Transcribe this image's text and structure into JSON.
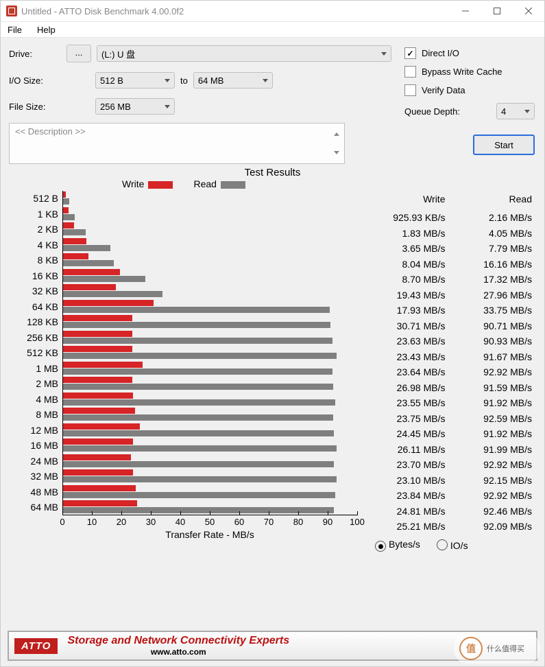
{
  "window": {
    "title": "Untitled - ATTO Disk Benchmark 4.00.0f2"
  },
  "menu": {
    "file": "File",
    "help": "Help"
  },
  "params": {
    "drive_label": "Drive:",
    "drive_value": "(L:) U 盘",
    "iosize_label": "I/O Size:",
    "iosize_from": "512 B",
    "iosize_to_label": "to",
    "iosize_to": "64 MB",
    "filesize_label": "File Size:",
    "filesize_value": "256 MB",
    "ellipsis": "..."
  },
  "options": {
    "direct_io": "Direct I/O",
    "bypass": "Bypass Write Cache",
    "verify": "Verify Data",
    "queue_depth_label": "Queue Depth:",
    "queue_depth_value": "4",
    "start": "Start"
  },
  "description": {
    "placeholder": "<< Description >>"
  },
  "results_title": "Test Results",
  "legend": {
    "write": "Write",
    "read": "Read"
  },
  "xaxis_title": "Transfer Rate - MB/s",
  "value_header": {
    "write": "Write",
    "read": "Read"
  },
  "unit": {
    "bytes": "Bytes/s",
    "ios": "IO/s"
  },
  "footer": {
    "logo": "ATTO",
    "text": "Storage and Network Connectivity Experts",
    "sub": "www.atto.com"
  },
  "watermark": {
    "glyph": "值",
    "text": "什么值得买"
  },
  "chart_data": {
    "type": "bar",
    "title": "Test Results",
    "xlabel": "Transfer Rate - MB/s",
    "ylabel": "",
    "xlim": [
      0,
      100
    ],
    "xticks": [
      0,
      10,
      20,
      30,
      40,
      50,
      60,
      70,
      80,
      90,
      100
    ],
    "categories": [
      "512 B",
      "1 KB",
      "2 KB",
      "4 KB",
      "8 KB",
      "16 KB",
      "32 KB",
      "64 KB",
      "128 KB",
      "256 KB",
      "512 KB",
      "1 MB",
      "2 MB",
      "4 MB",
      "8 MB",
      "12 MB",
      "16 MB",
      "24 MB",
      "32 MB",
      "48 MB",
      "64 MB"
    ],
    "series": [
      {
        "name": "Write",
        "color": "#d62427",
        "values_mb_s": [
          0.926,
          1.83,
          3.65,
          8.04,
          8.7,
          19.43,
          17.93,
          30.71,
          23.63,
          23.43,
          23.64,
          26.98,
          23.55,
          23.75,
          24.45,
          26.11,
          23.7,
          23.1,
          23.84,
          24.81,
          25.21
        ],
        "display": [
          "925.93 KB/s",
          "1.83 MB/s",
          "3.65 MB/s",
          "8.04 MB/s",
          "8.70 MB/s",
          "19.43 MB/s",
          "17.93 MB/s",
          "30.71 MB/s",
          "23.63 MB/s",
          "23.43 MB/s",
          "23.64 MB/s",
          "26.98 MB/s",
          "23.55 MB/s",
          "23.75 MB/s",
          "24.45 MB/s",
          "26.11 MB/s",
          "23.70 MB/s",
          "23.10 MB/s",
          "23.84 MB/s",
          "24.81 MB/s",
          "25.21 MB/s"
        ]
      },
      {
        "name": "Read",
        "color": "#7f7f7f",
        "values_mb_s": [
          2.16,
          4.05,
          7.79,
          16.16,
          17.32,
          27.96,
          33.75,
          90.71,
          90.93,
          91.67,
          92.92,
          91.59,
          91.92,
          92.59,
          91.92,
          91.99,
          92.92,
          92.15,
          92.92,
          92.46,
          92.09
        ],
        "display": [
          "2.16 MB/s",
          "4.05 MB/s",
          "7.79 MB/s",
          "16.16 MB/s",
          "17.32 MB/s",
          "27.96 MB/s",
          "33.75 MB/s",
          "90.71 MB/s",
          "90.93 MB/s",
          "91.67 MB/s",
          "92.92 MB/s",
          "91.59 MB/s",
          "91.92 MB/s",
          "92.59 MB/s",
          "91.92 MB/s",
          "91.99 MB/s",
          "92.92 MB/s",
          "92.15 MB/s",
          "92.92 MB/s",
          "92.46 MB/s",
          "92.09 MB/s"
        ]
      }
    ]
  }
}
